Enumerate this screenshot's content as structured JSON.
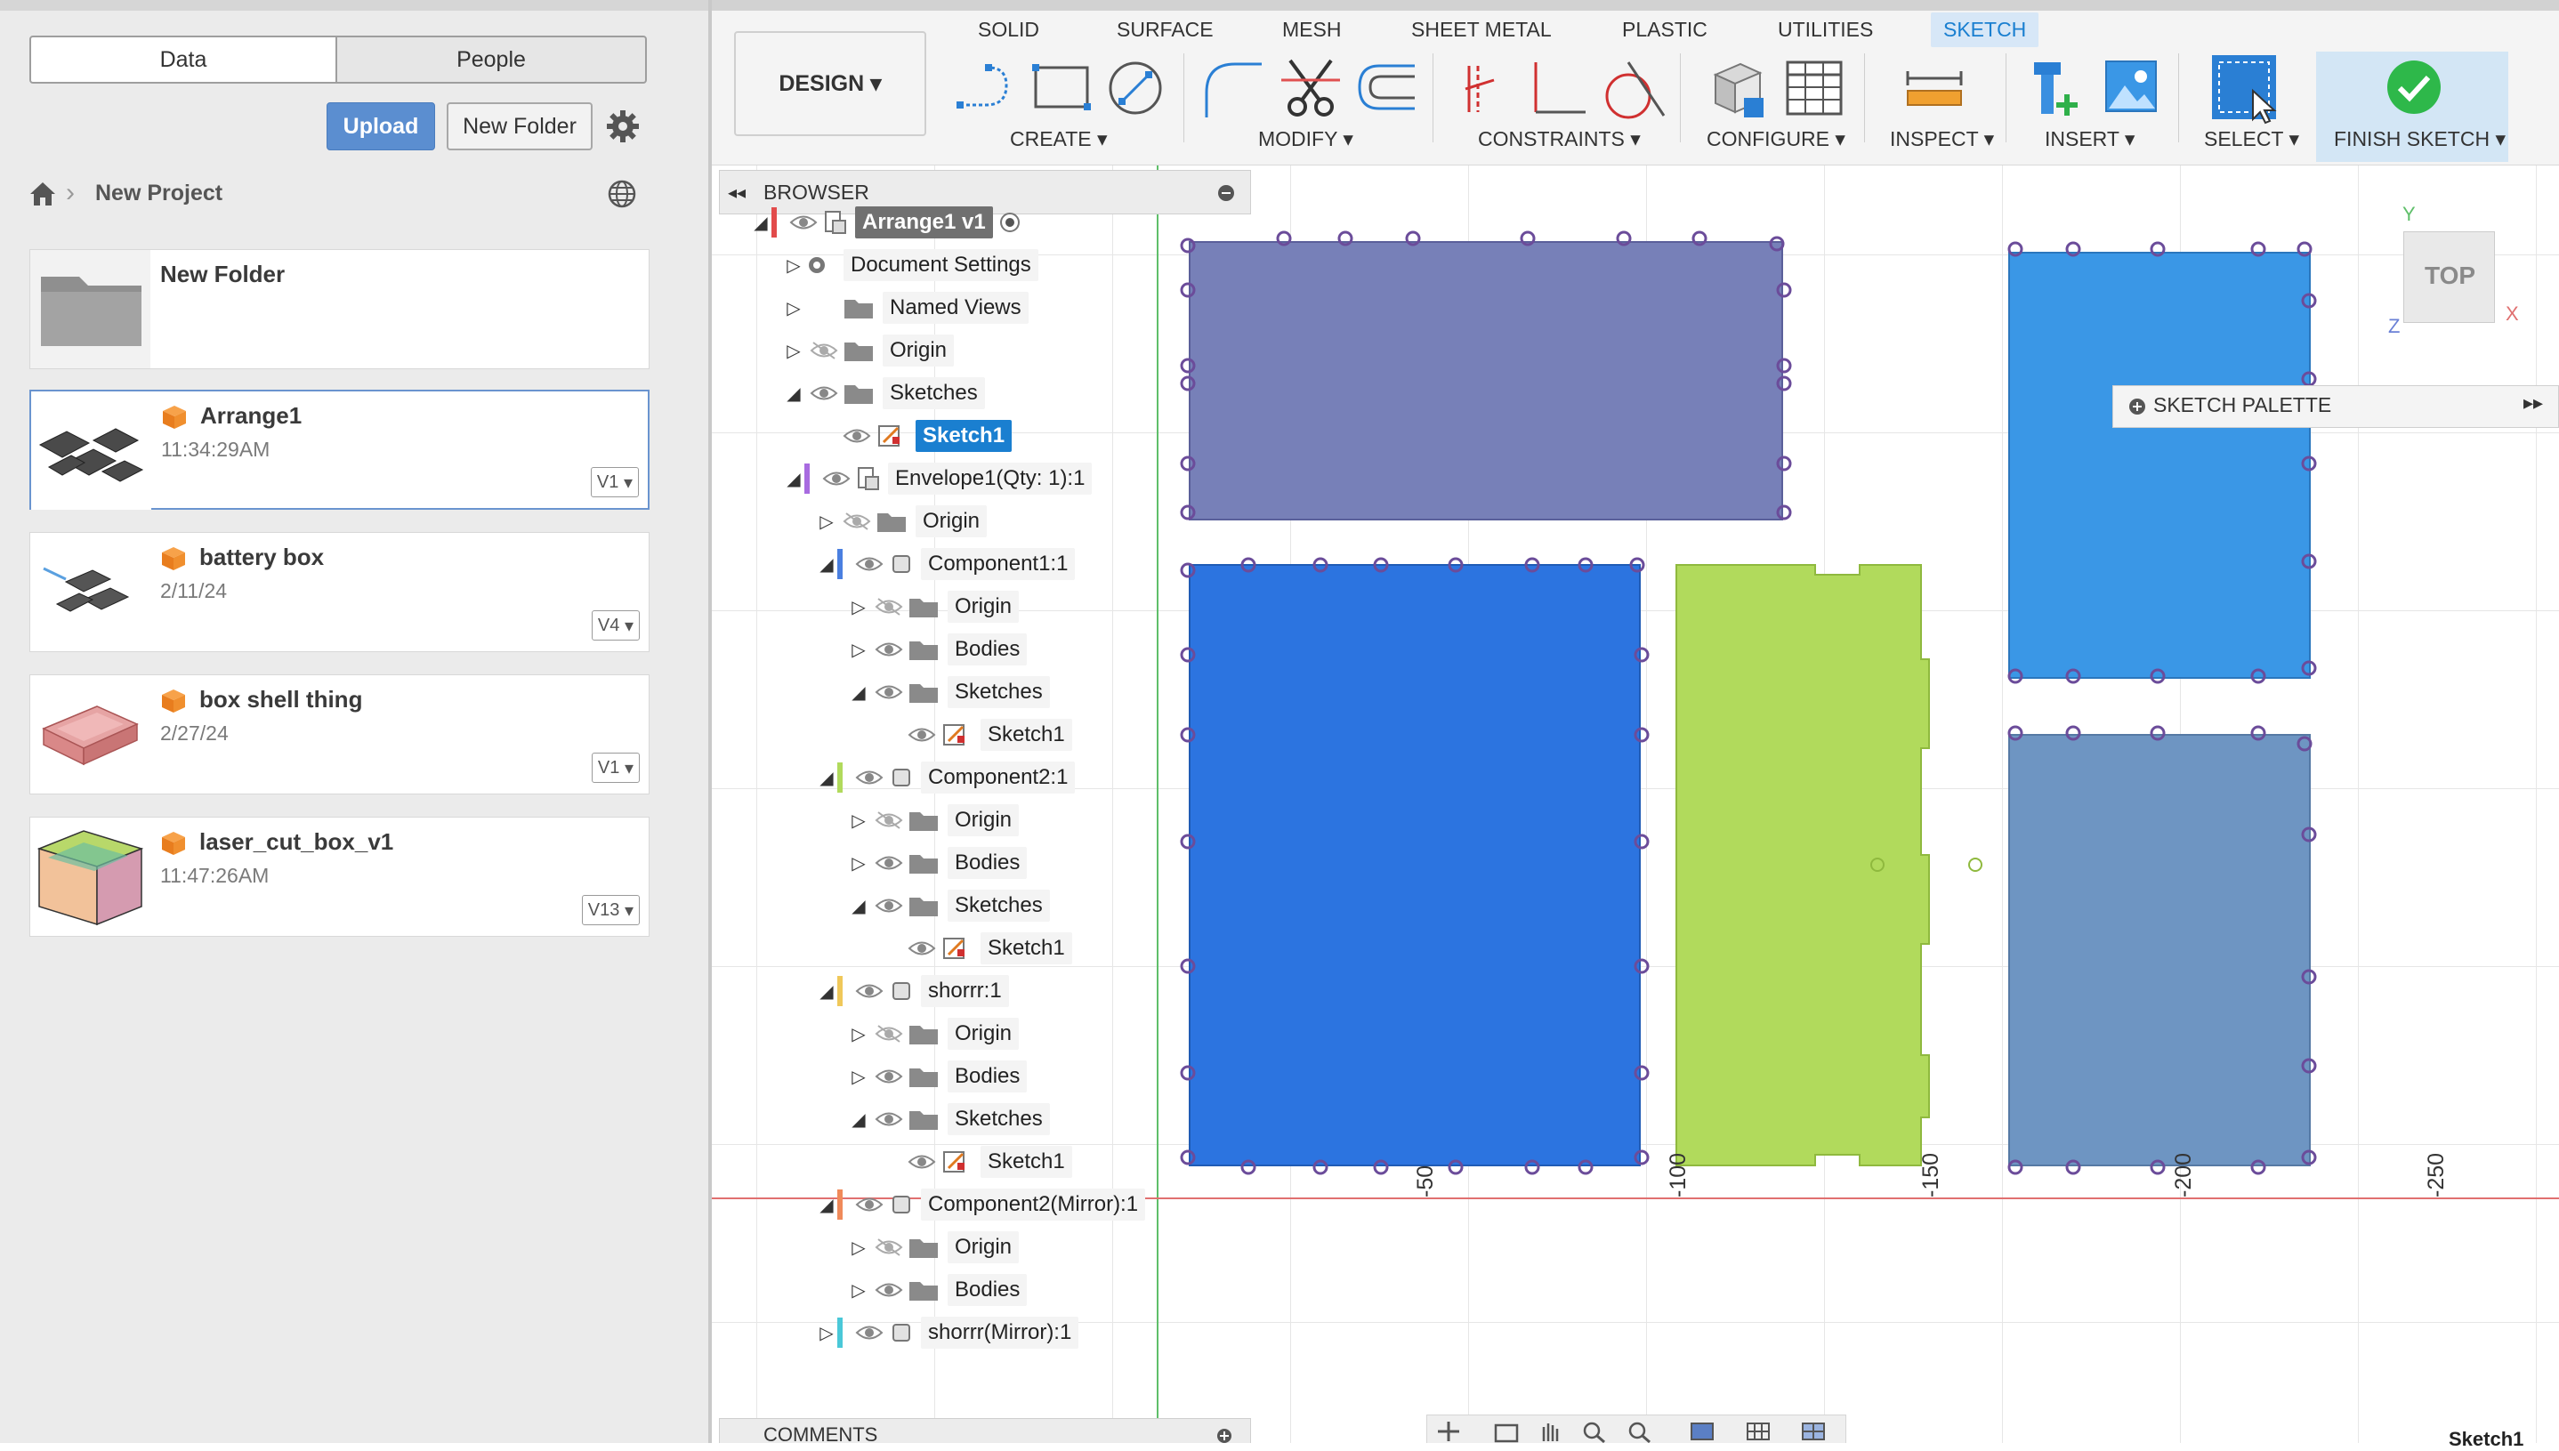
{
  "data_panel": {
    "tabs": [
      "Data",
      "People"
    ],
    "upload_label": "Upload",
    "new_folder_label": "New Folder",
    "breadcrumb": "New Project",
    "items": [
      {
        "title": "New Folder",
        "time": "",
        "version": ""
      },
      {
        "title": "Arrange1",
        "time": "11:34:29AM",
        "version": "V1"
      },
      {
        "title": "battery box",
        "time": "2/11/24",
        "version": "V4"
      },
      {
        "title": "box shell thing",
        "time": "2/27/24",
        "version": "V1"
      },
      {
        "title": "laser_cut_box_v1",
        "time": "11:47:26AM",
        "version": "V13"
      }
    ]
  },
  "toolbar": {
    "workspace_label": "DESIGN",
    "tabs": [
      "SOLID",
      "SURFACE",
      "MESH",
      "SHEET METAL",
      "PLASTIC",
      "UTILITIES",
      "SKETCH"
    ],
    "groups": [
      "CREATE",
      "MODIFY",
      "CONSTRAINTS",
      "CONFIGURE",
      "INSPECT",
      "INSERT",
      "SELECT",
      "FINISH SKETCH"
    ]
  },
  "browser": {
    "title": "BROWSER",
    "nodes": [
      {
        "label": "Arrange1 v1"
      },
      {
        "label": "Document Settings"
      },
      {
        "label": "Named Views"
      },
      {
        "label": "Origin"
      },
      {
        "label": "Sketches"
      },
      {
        "label": "Sketch1"
      },
      {
        "label": "Envelope1(Qty: 1):1"
      },
      {
        "label": "Origin"
      },
      {
        "label": "Component1:1"
      },
      {
        "label": "Origin"
      },
      {
        "label": "Bodies"
      },
      {
        "label": "Sketches"
      },
      {
        "label": "Sketch1"
      },
      {
        "label": "Component2:1"
      },
      {
        "label": "Origin"
      },
      {
        "label": "Bodies"
      },
      {
        "label": "Sketches"
      },
      {
        "label": "Sketch1"
      },
      {
        "label": "shorrr:1"
      },
      {
        "label": "Origin"
      },
      {
        "label": "Bodies"
      },
      {
        "label": "Sketches"
      },
      {
        "label": "Sketch1"
      },
      {
        "label": "Component2(Mirror):1"
      },
      {
        "label": "Origin"
      },
      {
        "label": "Bodies"
      },
      {
        "label": "shorrr(Mirror):1"
      }
    ],
    "comments_label": "COMMENTS"
  },
  "sketch_palette": "SKETCH PALETTE",
  "viewcube": {
    "label": "TOP",
    "x_axis": "X",
    "y_axis": "Y",
    "z_axis": "Z"
  },
  "axis_ticks": [
    "-50",
    "-100",
    "-150",
    "-200",
    "-250"
  ],
  "status": "Sketch1",
  "colors": {
    "accent": "#1a7fd0",
    "upload": "#5b8ed0",
    "panel_slate": "#7780b8",
    "panel_blue": "#2c74e0",
    "panel_green": "#b1da5c",
    "panel_sky": "#3a97e6",
    "panel_steel": "#6e95c2"
  }
}
